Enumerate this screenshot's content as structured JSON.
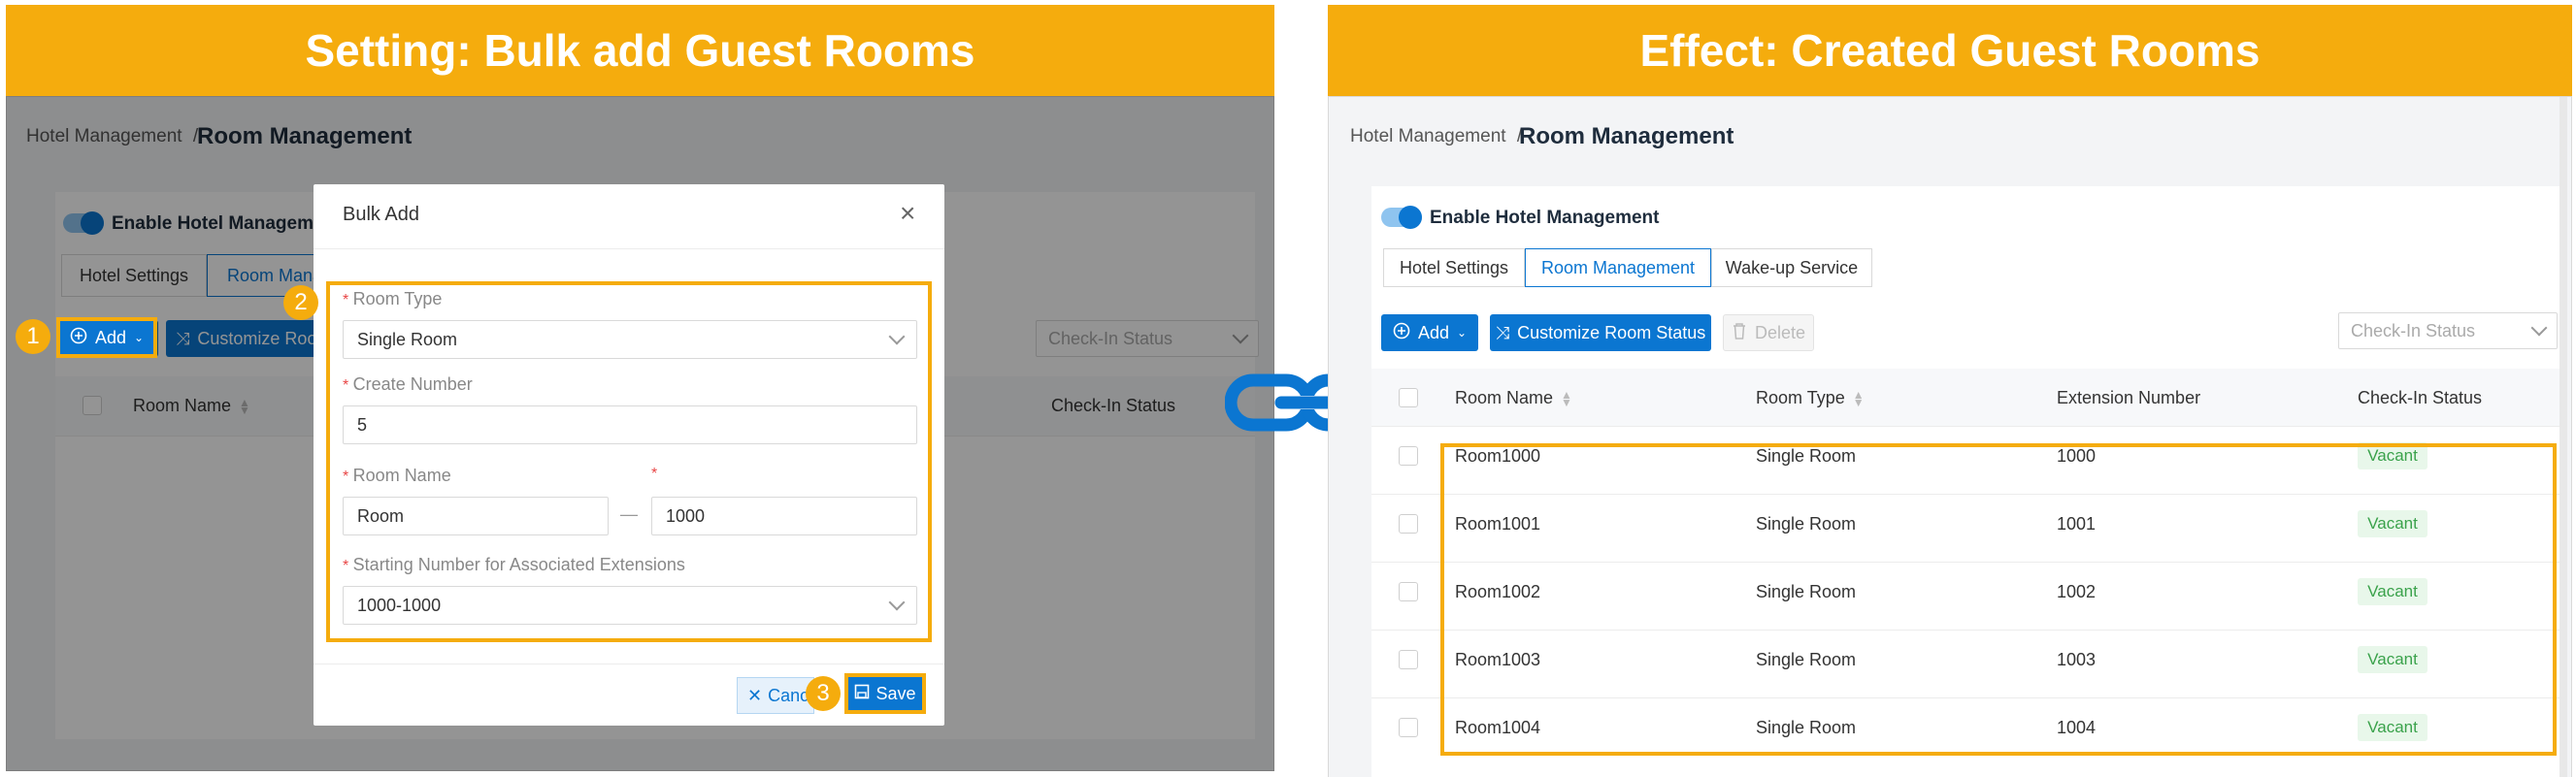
{
  "left_banner": "Setting: Bulk add Guest Rooms",
  "right_banner": "Effect: Created Guest Rooms",
  "breadcrumb": {
    "parent": "Hotel Management",
    "separator": "/",
    "current": "Room Management"
  },
  "enable_label": "Enable Hotel Management",
  "left_enable_label": "Enable Hotel Manageme",
  "tabs": [
    "Hotel Settings",
    "Room Management",
    "Wake-up Service"
  ],
  "left_tab2_label": "Room Mana",
  "toolbar": {
    "add": "Add",
    "customize": "Customize Room Status",
    "left_customize": "Customize Roo",
    "delete": "Delete"
  },
  "filter_placeholder": "Check-In Status",
  "columns": {
    "name": "Room Name",
    "type": "Room Type",
    "ext": "Extension Number",
    "status": "Check-In Status"
  },
  "rows": [
    {
      "name": "Room1000",
      "type": "Single Room",
      "ext": "1000",
      "status": "Vacant"
    },
    {
      "name": "Room1001",
      "type": "Single Room",
      "ext": "1001",
      "status": "Vacant"
    },
    {
      "name": "Room1002",
      "type": "Single Room",
      "ext": "1002",
      "status": "Vacant"
    },
    {
      "name": "Room1003",
      "type": "Single Room",
      "ext": "1003",
      "status": "Vacant"
    },
    {
      "name": "Room1004",
      "type": "Single Room",
      "ext": "1004",
      "status": "Vacant"
    }
  ],
  "modal": {
    "title": "Bulk Add",
    "close": "×",
    "room_type_label": "Room Type",
    "room_type_value": "Single Room",
    "create_number_label": "Create Number",
    "create_number_value": "5",
    "room_name_label": "Room Name",
    "room_name_prefix": "Room",
    "dash": "—",
    "room_name_start": "1000",
    "ext_label": "Starting Number for Associated Extensions",
    "ext_value": "1000-1000",
    "cancel": "Canc",
    "save": "Save"
  },
  "steps": [
    "1",
    "2",
    "3"
  ],
  "colors": {
    "accent": "#f5ac0d",
    "primary": "#0b76d1",
    "vacant": "#3aa24b"
  },
  "icons": [
    "plus-circle-icon",
    "chevron-down-icon",
    "shuffle-icon",
    "trash-icon",
    "sort-icon",
    "close-icon",
    "save-icon",
    "link-icon"
  ]
}
